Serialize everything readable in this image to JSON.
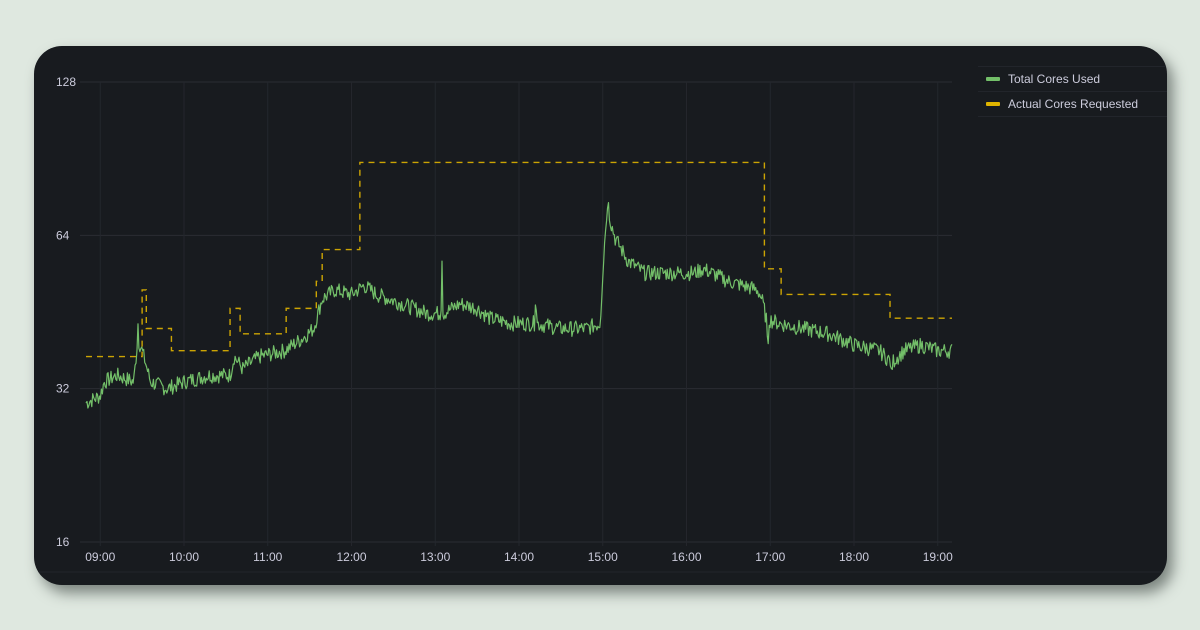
{
  "chart_data": {
    "type": "line",
    "title": "",
    "xlabel": "",
    "ylabel": "",
    "y_scale": "log2",
    "ylim": [
      16,
      128
    ],
    "yticks": [
      16,
      32,
      64,
      128
    ],
    "ytick_labels": [
      "16",
      "32",
      "64",
      "128"
    ],
    "xlim_hours": [
      8.83,
      19.17
    ],
    "xticks_hours": [
      9,
      10,
      11,
      12,
      13,
      14,
      15,
      16,
      17,
      18,
      19
    ],
    "xtick_labels": [
      "09:00",
      "10:00",
      "11:00",
      "12:00",
      "13:00",
      "14:00",
      "15:00",
      "16:00",
      "17:00",
      "18:00",
      "19:00"
    ],
    "grid": true,
    "legend_position": "top-right",
    "series": [
      {
        "name": "Total Cores Used",
        "color": "#73bf69",
        "style": "solid",
        "anchors": [
          [
            8.83,
            30
          ],
          [
            9.0,
            31
          ],
          [
            9.05,
            33
          ],
          [
            9.2,
            34
          ],
          [
            9.4,
            33
          ],
          [
            9.45,
            40
          ],
          [
            9.5,
            38
          ],
          [
            9.6,
            33
          ],
          [
            9.8,
            32
          ],
          [
            10.0,
            33
          ],
          [
            10.3,
            34
          ],
          [
            10.55,
            34
          ],
          [
            10.6,
            37
          ],
          [
            10.7,
            35
          ],
          [
            10.9,
            37
          ],
          [
            11.2,
            38
          ],
          [
            11.4,
            40
          ],
          [
            11.55,
            42
          ],
          [
            11.65,
            48
          ],
          [
            11.8,
            50
          ],
          [
            12.0,
            49
          ],
          [
            12.15,
            51
          ],
          [
            12.3,
            49
          ],
          [
            12.6,
            47
          ],
          [
            12.9,
            45
          ],
          [
            13.1,
            45
          ],
          [
            13.3,
            47
          ],
          [
            13.5,
            46
          ],
          [
            13.65,
            44
          ],
          [
            13.9,
            43
          ],
          [
            14.2,
            43
          ],
          [
            14.5,
            42
          ],
          [
            14.8,
            42
          ],
          [
            14.97,
            43
          ],
          [
            15.05,
            72
          ],
          [
            15.15,
            63
          ],
          [
            15.3,
            57
          ],
          [
            15.5,
            54
          ],
          [
            15.8,
            54
          ],
          [
            16.1,
            54
          ],
          [
            16.2,
            55
          ],
          [
            16.5,
            52
          ],
          [
            16.85,
            50
          ],
          [
            16.9,
            48
          ],
          [
            16.95,
            44
          ],
          [
            17.1,
            43
          ],
          [
            17.4,
            42
          ],
          [
            17.7,
            41
          ],
          [
            18.0,
            39
          ],
          [
            18.3,
            38
          ],
          [
            18.45,
            36
          ],
          [
            18.6,
            38
          ],
          [
            18.8,
            39
          ],
          [
            19.0,
            38
          ],
          [
            19.17,
            38
          ]
        ],
        "spikes": [
          [
            9.45,
            43
          ],
          [
            13.08,
            58
          ],
          [
            14.2,
            50
          ],
          [
            15.07,
            75
          ],
          [
            16.97,
            36
          ],
          [
            18.45,
            34
          ]
        ]
      },
      {
        "name": "Actual Cores Requested",
        "color": "#e0b400",
        "style": "dashed",
        "steps": [
          [
            8.83,
            37
          ],
          [
            9.5,
            50
          ],
          [
            9.55,
            42
          ],
          [
            9.85,
            38
          ],
          [
            10.55,
            46
          ],
          [
            10.67,
            41
          ],
          [
            11.22,
            46
          ],
          [
            11.58,
            52
          ],
          [
            11.65,
            60
          ],
          [
            12.1,
            89
          ],
          [
            16.93,
            55
          ],
          [
            17.13,
            49
          ],
          [
            18.43,
            44
          ],
          [
            19.17,
            44
          ]
        ]
      }
    ]
  },
  "legend": {
    "items": [
      {
        "label": "Total Cores Used",
        "color": "#73bf69"
      },
      {
        "label": "Actual Cores Requested",
        "color": "#e0b400"
      }
    ]
  }
}
